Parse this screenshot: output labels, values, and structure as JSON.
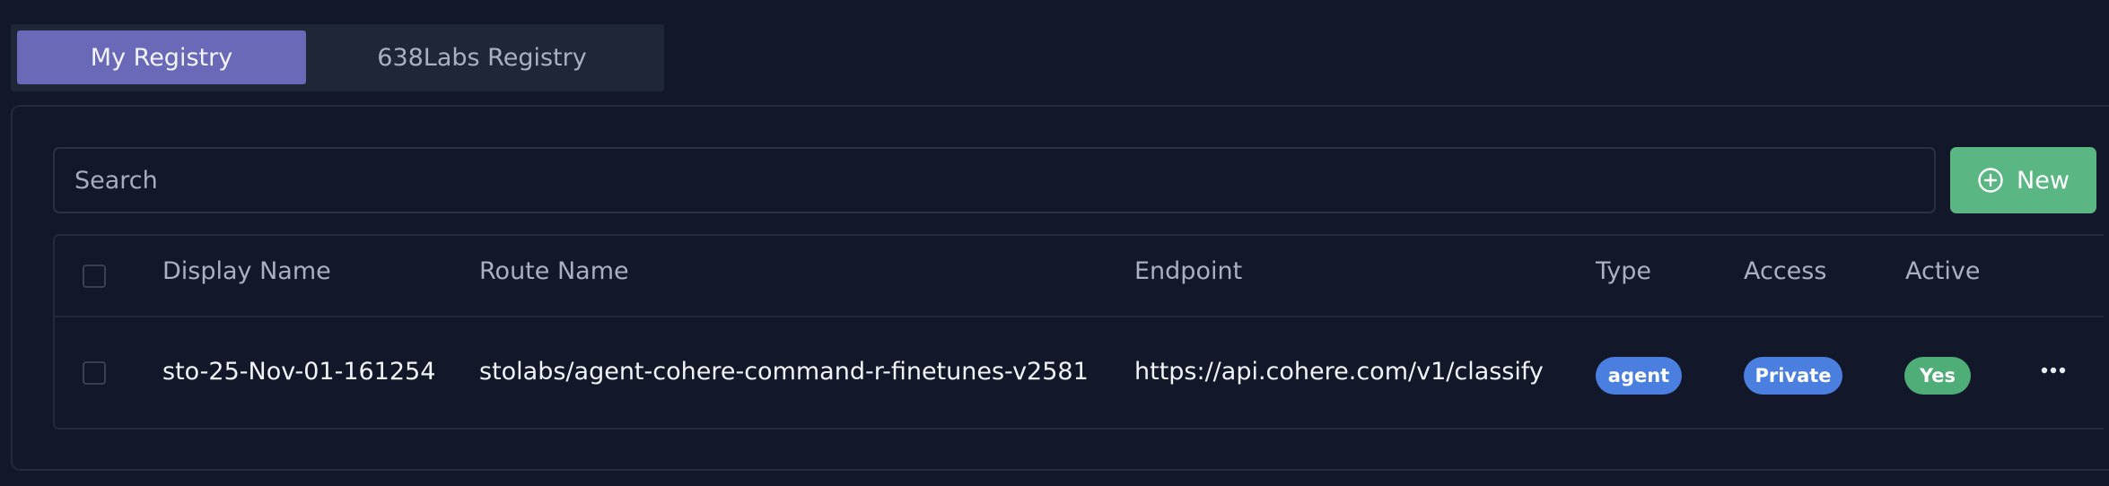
{
  "tabs": {
    "my_registry": "My Registry",
    "labs_registry": "638Labs Registry"
  },
  "search": {
    "placeholder": "Search"
  },
  "new_button": {
    "label": "New"
  },
  "table": {
    "columns": {
      "display_name": "Display Name",
      "route_name": "Route Name",
      "endpoint": "Endpoint",
      "type": "Type",
      "access": "Access",
      "active": "Active"
    },
    "rows": [
      {
        "display_name": "sto-25-Nov-01-161254",
        "route_name": "stolabs/agent-cohere-command-r-finetunes-v2581",
        "endpoint": "https://api.cohere.com/v1/classify",
        "type": "agent",
        "access": "Private",
        "active": "Yes"
      }
    ]
  },
  "colors": {
    "background": "#121729",
    "tab_active": "#6a69b8",
    "new_button": "#5ab784",
    "type_badge": "#4a7fe0",
    "access_badge": "#4a7fe0",
    "active_badge": "#4fae78"
  },
  "icons": {
    "new": "plus-circle-icon",
    "row_menu": "more-horizontal-icon"
  }
}
